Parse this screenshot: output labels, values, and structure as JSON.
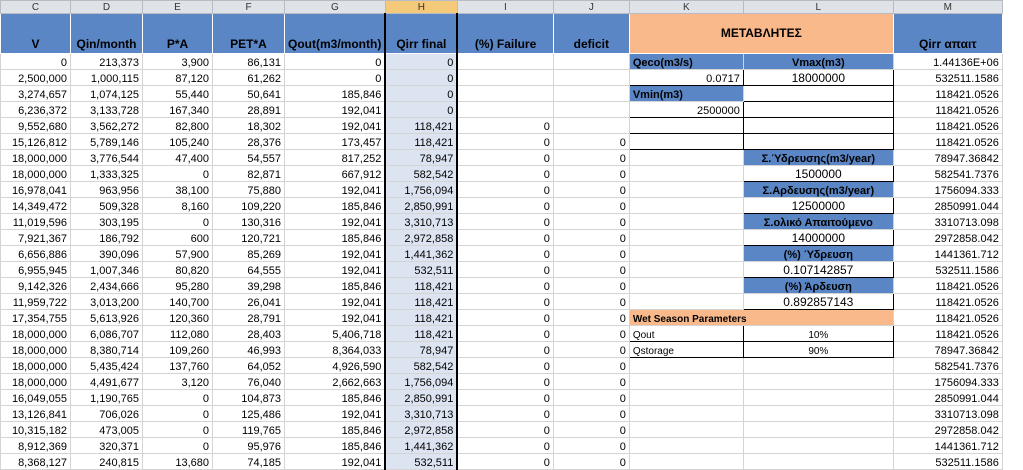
{
  "columns": [
    "C",
    "D",
    "E",
    "F",
    "G",
    "H",
    "I",
    "J",
    "K",
    "L",
    "M"
  ],
  "selected_column": "H",
  "headers": {
    "C": "V",
    "D": "Qin/month",
    "E": "P*A",
    "F": "PET*A",
    "G": "Qout(m3/month)",
    "H": "Qirr final",
    "I": "(%) Failure",
    "J": "deficit",
    "KL": "ΜΕΤΑΒΛΗΤΕΣ",
    "M": "Qirr απαιτ"
  },
  "rows": [
    [
      "0",
      "213,373",
      "3,900",
      "86,131",
      "0",
      "0",
      "",
      "",
      "",
      "",
      "1.44136E+06"
    ],
    [
      "2,500,000",
      "1,000,115",
      "87,120",
      "61,262",
      "0",
      "0",
      "",
      "",
      "",
      "",
      "532511.1586"
    ],
    [
      "3,274,657",
      "1,074,125",
      "55,440",
      "50,641",
      "185,846",
      "0",
      "",
      "",
      "",
      "",
      "118421.0526"
    ],
    [
      "6,236,372",
      "3,133,728",
      "167,340",
      "28,891",
      "192,041",
      "0",
      "",
      "",
      "",
      "",
      "118421.0526"
    ],
    [
      "9,552,680",
      "3,562,272",
      "82,800",
      "18,302",
      "192,041",
      "118,421",
      "0",
      "",
      "",
      "",
      "118421.0526"
    ],
    [
      "15,126,812",
      "5,789,146",
      "105,240",
      "28,376",
      "173,457",
      "118,421",
      "0",
      "0",
      "",
      "",
      "118421.0526"
    ],
    [
      "18,000,000",
      "3,776,544",
      "47,400",
      "54,557",
      "817,252",
      "78,947",
      "0",
      "0",
      "",
      "",
      "78947.36842"
    ],
    [
      "18,000,000",
      "1,333,325",
      "0",
      "82,871",
      "667,912",
      "582,542",
      "0",
      "0",
      "",
      "",
      "582541.7376"
    ],
    [
      "16,978,041",
      "963,956",
      "38,100",
      "75,880",
      "192,041",
      "1,756,094",
      "0",
      "0",
      "",
      "",
      "1756094.333"
    ],
    [
      "14,349,472",
      "509,328",
      "8,160",
      "109,220",
      "185,846",
      "2,850,991",
      "0",
      "0",
      "",
      "",
      "2850991.044"
    ],
    [
      "11,019,596",
      "303,195",
      "0",
      "130,316",
      "192,041",
      "3,310,713",
      "0",
      "0",
      "",
      "",
      "3310713.098"
    ],
    [
      "7,921,367",
      "186,792",
      "600",
      "120,721",
      "185,846",
      "2,972,858",
      "0",
      "0",
      "",
      "",
      "2972858.042"
    ],
    [
      "6,656,886",
      "390,096",
      "57,900",
      "85,269",
      "192,041",
      "1,441,362",
      "0",
      "0",
      "",
      "",
      "1441361.712"
    ],
    [
      "6,955,945",
      "1,007,346",
      "80,820",
      "64,555",
      "192,041",
      "532,511",
      "0",
      "0",
      "",
      "",
      "532511.1586"
    ],
    [
      "9,142,326",
      "2,434,666",
      "95,280",
      "39,298",
      "185,846",
      "118,421",
      "0",
      "0",
      "",
      "",
      "118421.0526"
    ],
    [
      "11,959,722",
      "3,013,200",
      "140,700",
      "26,041",
      "192,041",
      "118,421",
      "0",
      "0",
      "",
      "",
      "118421.0526"
    ],
    [
      "17,354,755",
      "5,613,926",
      "120,360",
      "28,791",
      "192,041",
      "118,421",
      "0",
      "0",
      "",
      "",
      "118421.0526"
    ],
    [
      "18,000,000",
      "6,086,707",
      "112,080",
      "28,403",
      "5,406,718",
      "118,421",
      "0",
      "0",
      "",
      "",
      "118421.0526"
    ],
    [
      "18,000,000",
      "8,380,714",
      "109,260",
      "46,993",
      "8,364,033",
      "78,947",
      "0",
      "0",
      "",
      "",
      "78947.36842"
    ],
    [
      "18,000,000",
      "5,435,424",
      "137,760",
      "64,052",
      "4,926,590",
      "582,542",
      "0",
      "0",
      "",
      "",
      "582541.7376"
    ],
    [
      "18,000,000",
      "4,491,677",
      "3,120",
      "76,040",
      "2,662,663",
      "1,756,094",
      "0",
      "0",
      "",
      "",
      "1756094.333"
    ],
    [
      "16,049,055",
      "1,190,765",
      "0",
      "104,873",
      "185,846",
      "2,850,991",
      "0",
      "0",
      "",
      "",
      "2850991.044"
    ],
    [
      "13,126,841",
      "706,026",
      "0",
      "125,486",
      "192,041",
      "3,310,713",
      "0",
      "0",
      "",
      "",
      "3310713.098"
    ],
    [
      "10,315,182",
      "473,005",
      "0",
      "119,765",
      "185,846",
      "2,972,858",
      "0",
      "0",
      "",
      "",
      "2972858.042"
    ],
    [
      "8,912,369",
      "320,371",
      "0",
      "95,976",
      "185,846",
      "1,441,362",
      "0",
      "0",
      "",
      "",
      "1441361.712"
    ],
    [
      "8,368,127",
      "240,815",
      "13,680",
      "74,185",
      "192,041",
      "532,511",
      "0",
      "0",
      "",
      "",
      "532511.1586"
    ]
  ],
  "variables": {
    "qeco_label": "Qeco(m3/s)",
    "qeco_value": "0.0717",
    "vmax_label": "Vmax(m3)",
    "vmax_value": "18000000",
    "vmin_label": "Vmin(m3)",
    "vmin_value": "2500000",
    "water_supply_label": "Σ.Ύδρευσης(m3/year)",
    "water_supply_value": "1500000",
    "irrigation_label": "Σ.Αρδευσης(m3/year)",
    "irrigation_value": "12500000",
    "total_label": "Σ.ολικό Απαιτούμενο",
    "total_value": "14000000",
    "pct_supply_label": "(%) Ύδρευση",
    "pct_supply_value": "0.107142857",
    "pct_irr_label": "(%) Άρδευση",
    "pct_irr_value": "0.892857143",
    "wet_label": "Wet Season Parameters",
    "qout_label": "Qout",
    "qout_value": "10%",
    "qstorage_label": "Qstorage",
    "qstorage_value": "90%"
  }
}
